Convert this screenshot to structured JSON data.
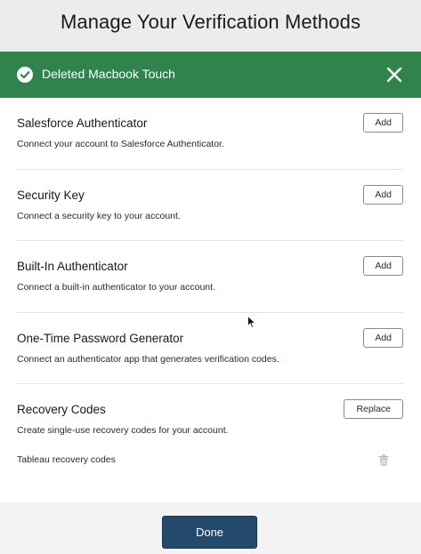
{
  "page": {
    "title": "Manage Your Verification Methods"
  },
  "toast": {
    "message": "Deleted Macbook Touch",
    "icon": "check-circle-icon",
    "close_icon": "close-icon",
    "color": "#2e844a"
  },
  "methods": [
    {
      "title": "Salesforce Authenticator",
      "description": "Connect your account to Salesforce Authenticator.",
      "button": "Add"
    },
    {
      "title": "Security Key",
      "description": "Connect a security key to your account.",
      "button": "Add"
    },
    {
      "title": "Built-In Authenticator",
      "description": "Connect a built-in authenticator to your account.",
      "button": "Add"
    },
    {
      "title": "One-Time Password Generator",
      "description": "Connect an authenticator app that generates verification codes.",
      "button": "Add"
    },
    {
      "title": "Recovery Codes",
      "description": "Create single-use recovery codes for your account.",
      "button": "Replace"
    }
  ],
  "recovery_item": {
    "label": "Tableau recovery codes",
    "icon": "trash-icon"
  },
  "footer": {
    "done_label": "Done",
    "done_color": "#234a6d"
  }
}
